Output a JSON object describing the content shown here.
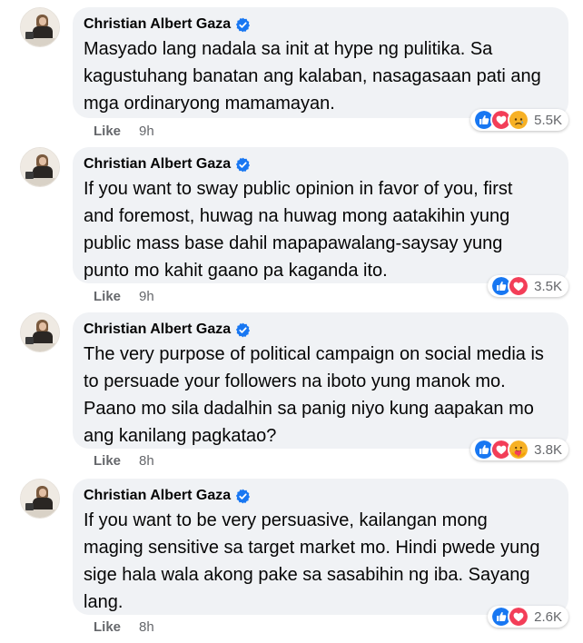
{
  "colors": {
    "like_blue": "#1877f2",
    "love_red": "#f33e58",
    "haha_yellow": "#f7b125",
    "bubble_bg": "#f0f2f5",
    "meta_gray": "#65676b"
  },
  "comments": [
    {
      "author": "Christian Albert Gaza",
      "verified": true,
      "lines": [
        "Masyado lang nadala sa init at hype ng pulitika. Sa",
        "kagustuhang banatan ang kalaban, nasagasaan pati ang",
        "mga ordinaryong mamamayan."
      ],
      "reactions": [
        "like-icon",
        "love-icon",
        "sad-icon"
      ],
      "reaction_count": "5.5K",
      "like_label": "Like",
      "time": "9h"
    },
    {
      "author": "Christian Albert Gaza",
      "verified": true,
      "lines": [
        "If you want to sway public opinion in favor of you, first",
        "and foremost, huwag na huwag mong aatakihin yung",
        "public mass base dahil mapapawalang-saysay yung",
        "punto mo kahit gaano pa kaganda ito."
      ],
      "reactions": [
        "like-icon",
        "love-icon"
      ],
      "reaction_count": "3.5K",
      "like_label": "Like",
      "time": "9h"
    },
    {
      "author": "Christian Albert Gaza",
      "verified": true,
      "lines": [
        "The very purpose of political campaign on social media is",
        "to persuade your followers na iboto yung manok mo.",
        "Paano mo sila dadalhin sa panig niyo kung aapakan mo",
        "ang kanilang pagkatao?"
      ],
      "reactions": [
        "like-icon",
        "love-icon",
        "care-icon"
      ],
      "reaction_count": "3.8K",
      "like_label": "Like",
      "time": "8h"
    },
    {
      "author": "Christian Albert Gaza",
      "verified": true,
      "lines": [
        "If you want to be very persuasive, kailangan mong",
        "maging sensitive sa target market mo. Hindi pwede yung",
        "sige hala wala akong pake sa sasabihin ng iba. Sayang",
        "lang."
      ],
      "reactions": [
        "like-icon",
        "love-icon"
      ],
      "reaction_count": "2.6K",
      "like_label": "Like",
      "time": "8h"
    }
  ]
}
